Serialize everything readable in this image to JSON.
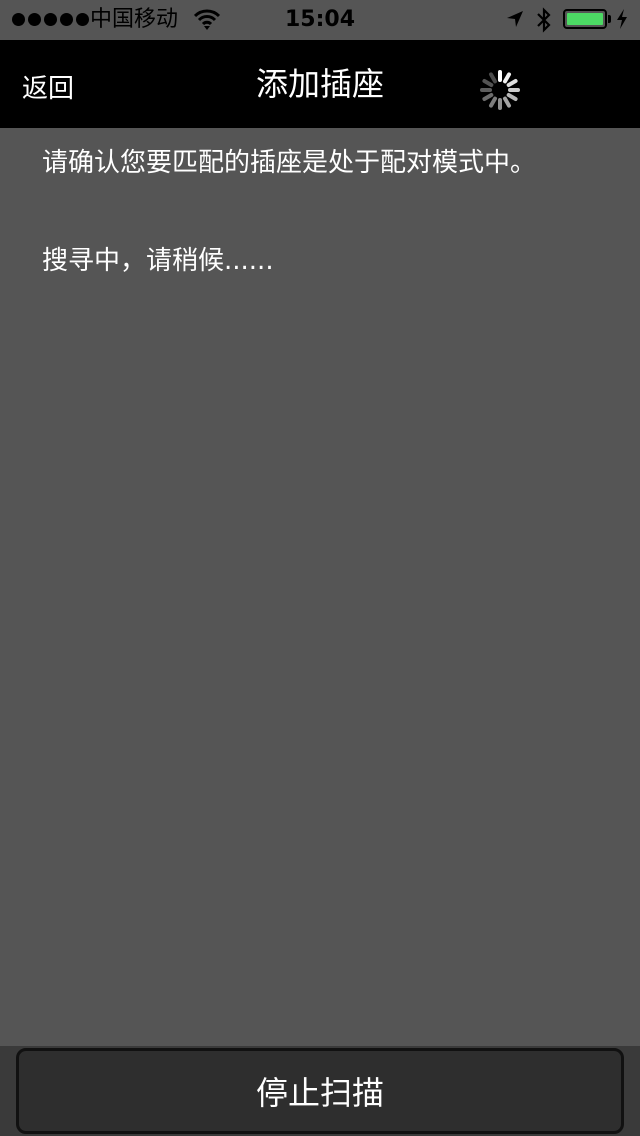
{
  "status_bar": {
    "carrier": "中国移动",
    "time": "15:04",
    "battery_color": "#4cd964"
  },
  "nav": {
    "back_label": "返回",
    "title": "添加插座"
  },
  "content": {
    "instruction": "请确认您要匹配的插座是处于配对模式中。",
    "searching": "搜寻中，请稍候......"
  },
  "bottom": {
    "stop_scan_label": "停止扫描"
  },
  "icons": {
    "signal": "signal-dots-icon",
    "wifi": "wifi-icon",
    "location": "location-arrow-icon",
    "bluetooth": "bluetooth-icon",
    "battery": "battery-icon",
    "charging": "charging-bolt-icon",
    "spinner": "loading-spinner-icon"
  }
}
